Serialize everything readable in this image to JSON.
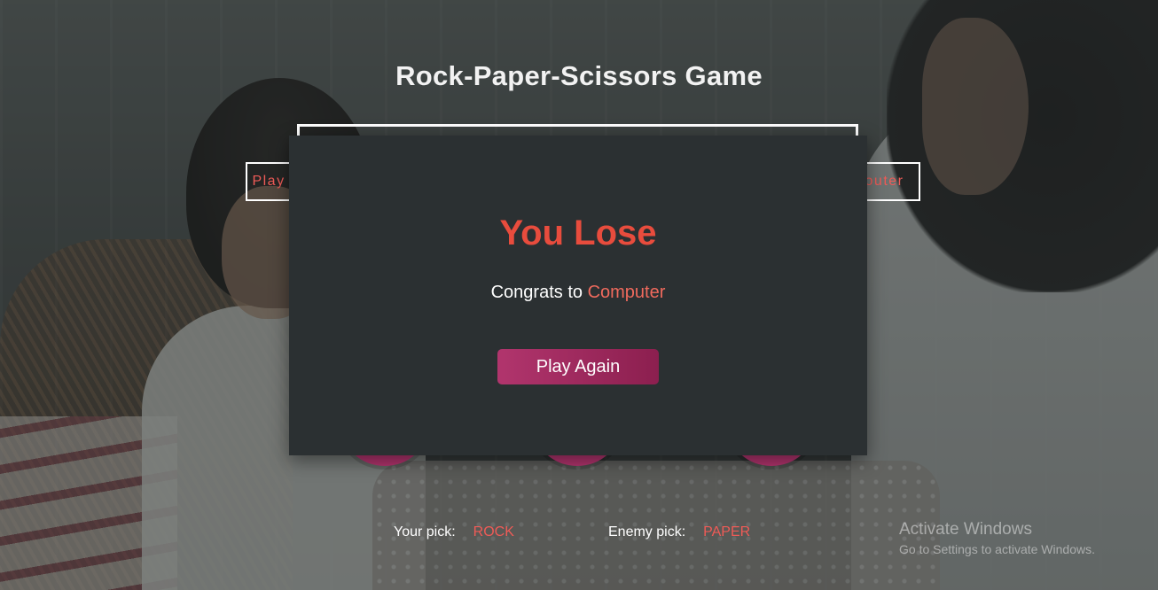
{
  "game": {
    "title": "Rock-Paper-Scissors Game",
    "player_label_partial": "Play",
    "computer_label_partial": "outer"
  },
  "modal": {
    "heading": "You Lose",
    "congrats_prefix": "Congrats to",
    "winner": "Computer",
    "play_again_label": "Play Again"
  },
  "picks": {
    "your_pick_label": "Your pick:",
    "your_pick_value": "ROCK",
    "enemy_pick_label": "Enemy pick:",
    "enemy_pick_value": "PAPER"
  },
  "watermark": {
    "title": "Activate Windows",
    "subtitle": "Go to Settings to activate Windows."
  },
  "colors": {
    "accent": "#ef5b57",
    "lose_heading": "#e84c3d",
    "button_start": "#b1356d",
    "button_end": "#8c1f4f",
    "modal_bg": "#2b3032"
  }
}
